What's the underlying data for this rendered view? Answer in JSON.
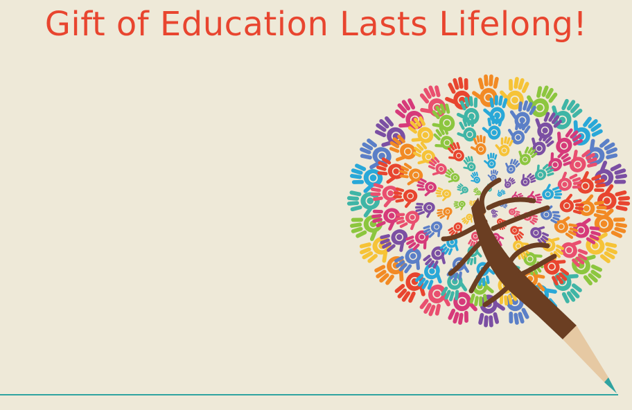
{
  "headline": {
    "text": "Gift of Education Lasts Lifelong!"
  },
  "artwork": {
    "subject": "pencil-tree-of-colorful-handprints",
    "hand_colors": [
      "#e8452f",
      "#f28a24",
      "#f6c337",
      "#8cc63f",
      "#3fb5a6",
      "#29a8d8",
      "#5b7fc7",
      "#7b4fa3",
      "#d63a7a",
      "#e94f6f"
    ]
  },
  "colors": {
    "background": "#eee9d8",
    "headline": "#e8452f",
    "trunk": "#6b3e22",
    "pencil_wood": "#e6c9a3",
    "pencil_lead": "#2fa3a0",
    "ground_line": "#2fa3a0"
  }
}
